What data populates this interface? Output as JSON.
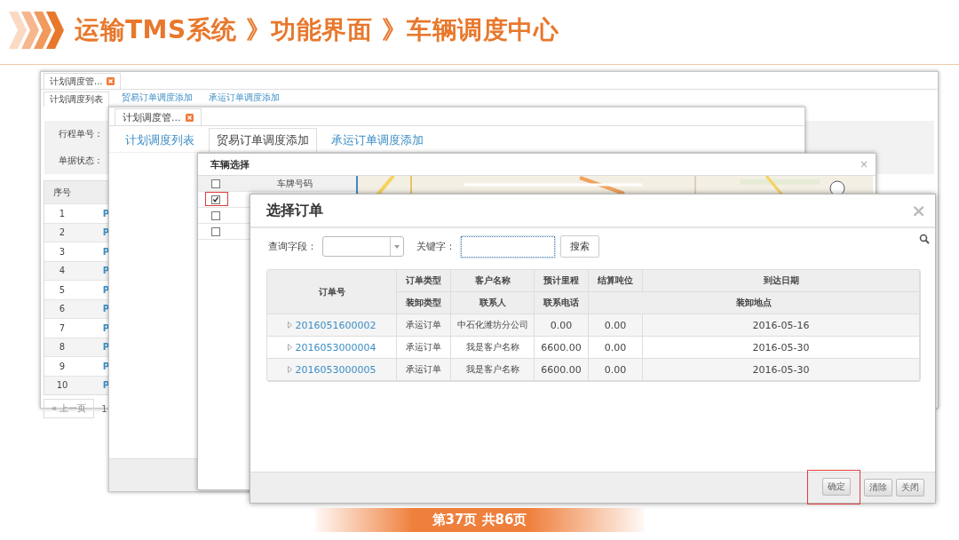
{
  "header": {
    "title": "运输TMS系统 》功能界面 》车辆调度中心"
  },
  "back_window": {
    "tab": "计划调度管...",
    "subtabs": [
      {
        "label": "计划调度列表",
        "selected": true
      },
      {
        "label": "贸易订单调度添加",
        "selected": false
      },
      {
        "label": "承运订单调度添加",
        "selected": false
      }
    ],
    "filters": [
      "行程单号：",
      "单据状态："
    ],
    "table": {
      "columns": [
        "序号"
      ],
      "rows": [
        {
          "index": "1",
          "link": "P"
        },
        {
          "index": "2",
          "link": "P"
        },
        {
          "index": "3",
          "link": "P"
        },
        {
          "index": "4",
          "link": "P"
        },
        {
          "index": "5",
          "link": "P"
        },
        {
          "index": "6",
          "link": "P"
        },
        {
          "index": "7",
          "link": "P"
        },
        {
          "index": "8",
          "link": "P"
        },
        {
          "index": "9",
          "link": "P"
        },
        {
          "index": "10",
          "link": "P"
        }
      ]
    },
    "pager": [
      "« 上一页",
      "1"
    ]
  },
  "middle_window": {
    "tab": "计划调度管...",
    "subtabs": [
      {
        "label": "计划调度列表",
        "selected": false
      },
      {
        "label": "贸易订单调度添加",
        "selected": true
      },
      {
        "label": "承运订单调度添加",
        "selected": false
      }
    ]
  },
  "vehicle_dialog": {
    "title": "车辆选择",
    "close_label": "×",
    "header_checked": false,
    "columns": [
      "车牌号码"
    ],
    "rows": [
      {
        "checked": true,
        "highlighted": true
      },
      {
        "checked": false,
        "highlighted": false
      },
      {
        "checked": false,
        "highlighted": false
      }
    ]
  },
  "order_dialog": {
    "title": "选择订单",
    "close_label": "×",
    "search": {
      "field_label": "查询字段：",
      "keyword_label": "关键字：",
      "button": "搜索"
    },
    "table": {
      "columns_top": [
        "订单号",
        "订单类型",
        "客户名称",
        "预计里程",
        "结算吨位",
        "到达日期"
      ],
      "columns_bottom": [
        "装卸类型",
        "联系人",
        "联系电话",
        "装卸地点"
      ],
      "rows": [
        {
          "order_no": "2016051600002",
          "type": "承运订单",
          "customer": "中石化潍坊分公司",
          "mileage": "0.00",
          "tonnage": "0.00",
          "date": "2016-05-16"
        },
        {
          "order_no": "2016053000004",
          "type": "承运订单",
          "customer": "我是客户名称",
          "mileage": "6600.00",
          "tonnage": "0.00",
          "date": "2016-05-30"
        },
        {
          "order_no": "2016053000005",
          "type": "承运订单",
          "customer": "我是客户名称",
          "mileage": "6600.00",
          "tonnage": "0.00",
          "date": "2016-05-30"
        }
      ]
    },
    "buttons": [
      {
        "label": "确定",
        "highlighted": true
      },
      {
        "label": "清除",
        "highlighted": false
      },
      {
        "label": "关闭",
        "highlighted": false
      }
    ]
  },
  "pagination": {
    "label": "第37页 共86页"
  }
}
